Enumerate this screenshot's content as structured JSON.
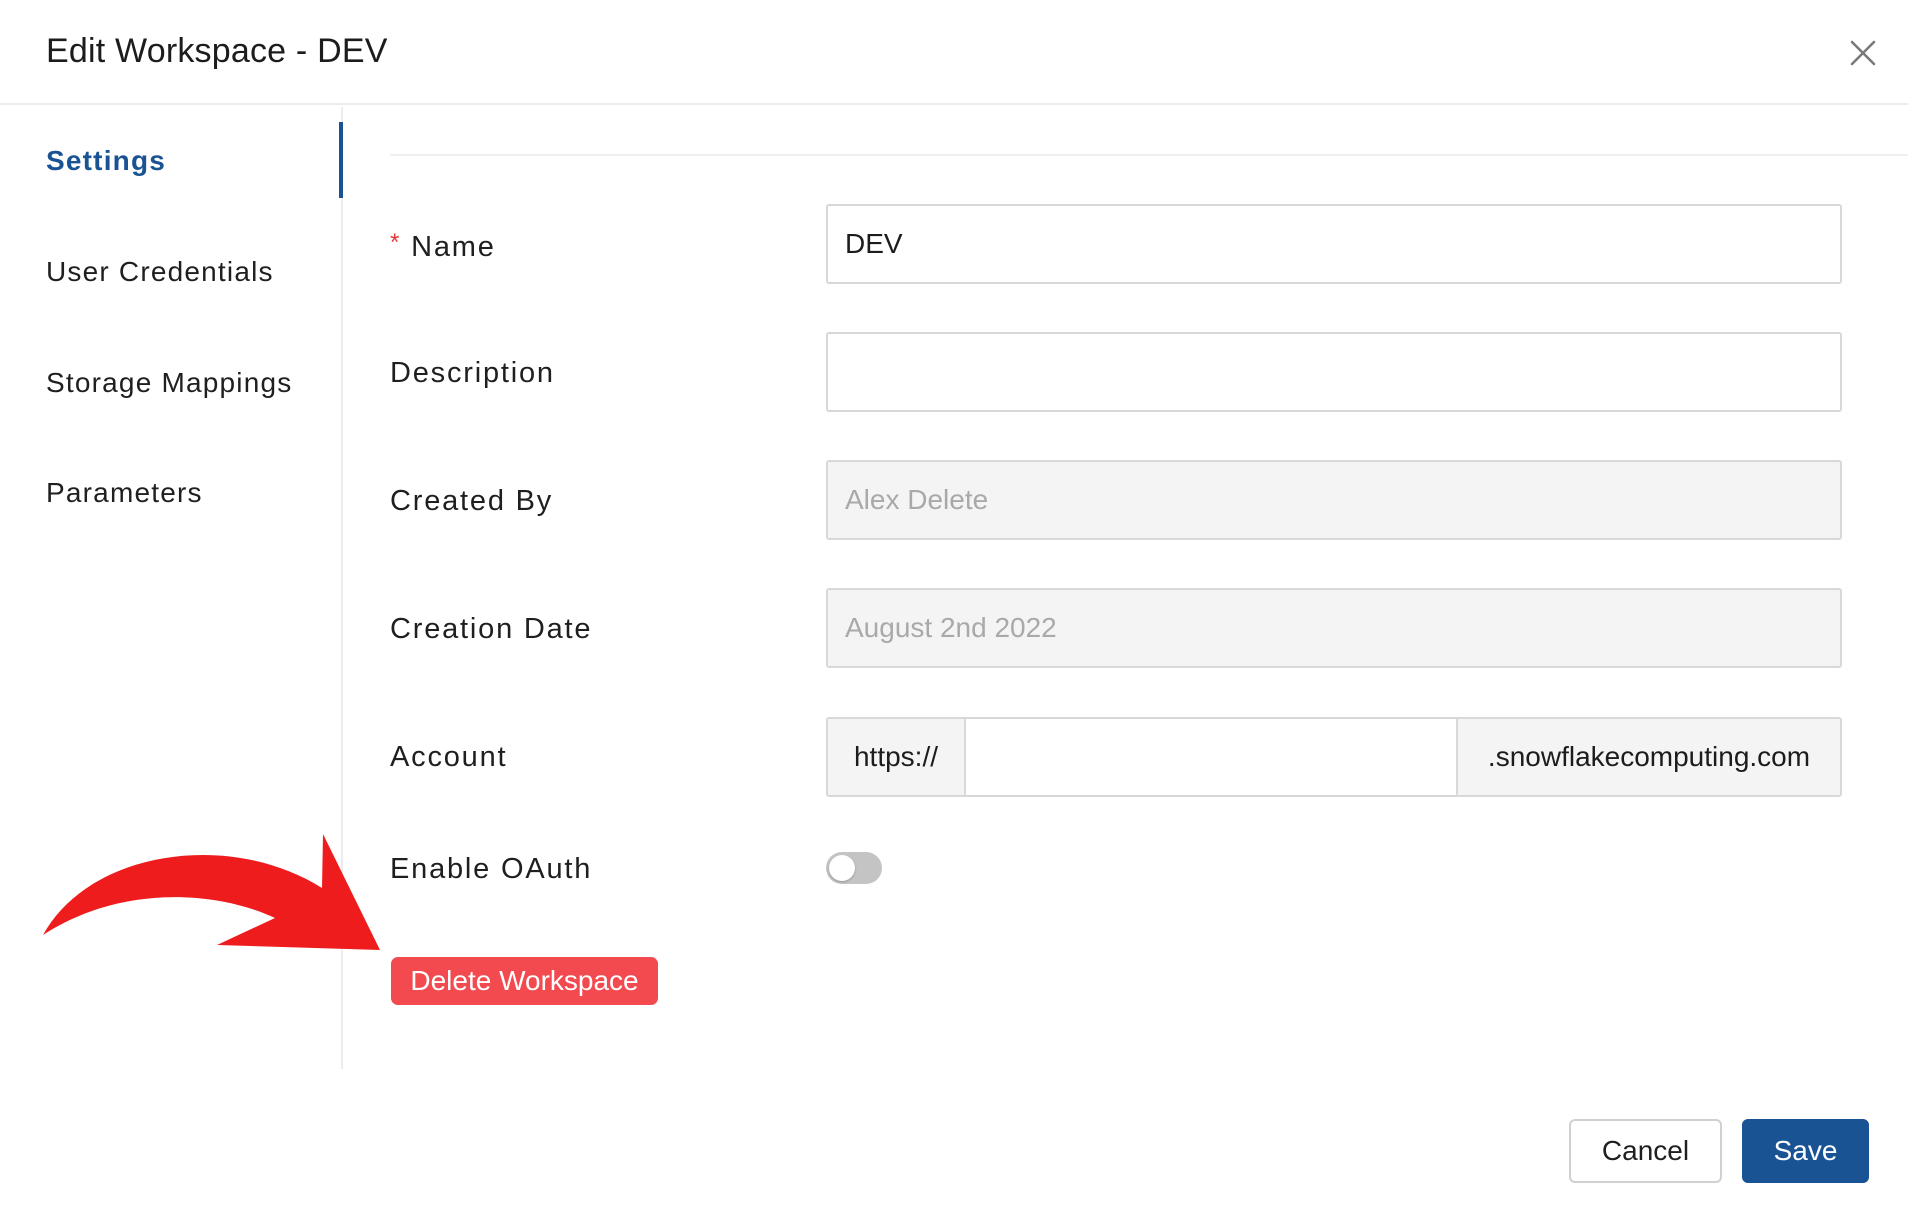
{
  "modal": {
    "title": "Edit Workspace - DEV"
  },
  "sidebar": {
    "items": [
      {
        "label": "Settings",
        "active": true
      },
      {
        "label": "User Credentials",
        "active": false
      },
      {
        "label": "Storage Mappings",
        "active": false
      },
      {
        "label": "Parameters",
        "active": false
      }
    ]
  },
  "form": {
    "name": {
      "label": "Name",
      "required_mark": "*",
      "value": "DEV"
    },
    "description": {
      "label": "Description",
      "value": ""
    },
    "created_by": {
      "label": "Created By",
      "placeholder": "Alex Delete"
    },
    "creation_date": {
      "label": "Creation Date",
      "placeholder": "August 2nd 2022"
    },
    "account": {
      "label": "Account",
      "prefix": "https://",
      "value": "",
      "suffix": ".snowflakecomputing.com"
    },
    "enable_oauth": {
      "label": "Enable OAuth",
      "enabled": false
    }
  },
  "actions": {
    "delete_label": "Delete Workspace",
    "cancel_label": "Cancel",
    "save_label": "Save"
  },
  "colors": {
    "accent": "#1a5394",
    "danger": "#f24a4f",
    "annotation_arrow": "#ee1c1c",
    "required": "#e53935"
  },
  "icons": {
    "close": "close-icon",
    "annotation": "arrow-icon"
  }
}
